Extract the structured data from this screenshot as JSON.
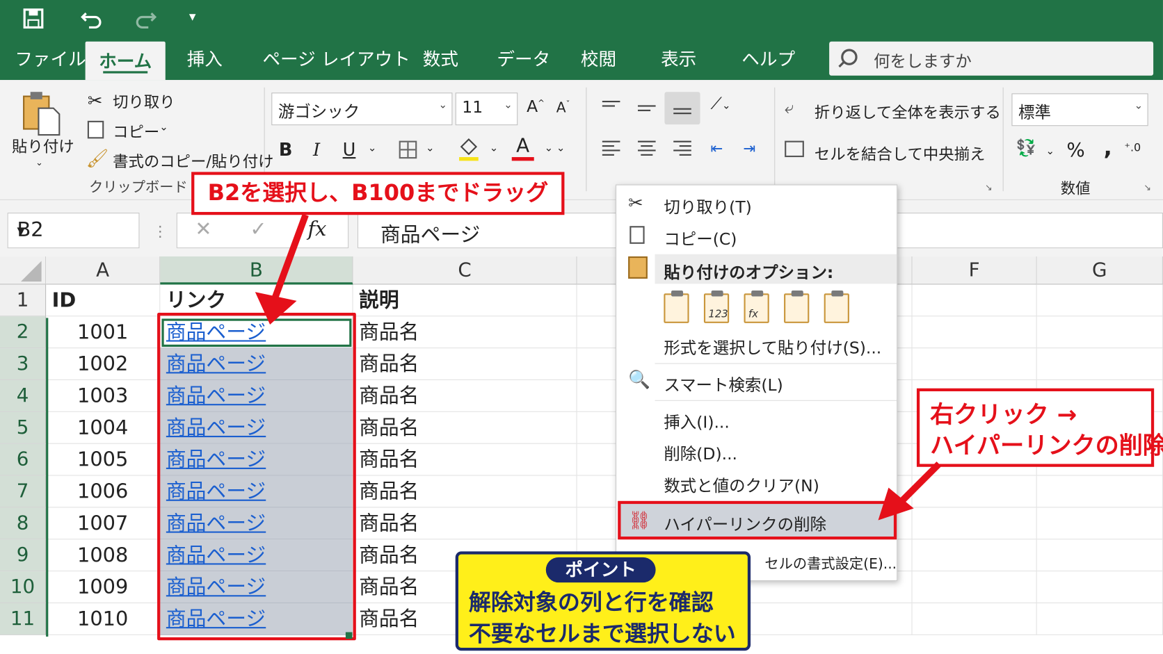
{
  "quick_access": {
    "save_icon": "save-icon",
    "undo_icon": "undo-icon",
    "redo_icon": "redo-icon",
    "customize": "▾"
  },
  "tabs": [
    {
      "label": "ファイル"
    },
    {
      "label": "ホーム",
      "active": true
    },
    {
      "label": "挿入"
    },
    {
      "label": "ページ レイアウト"
    },
    {
      "label": "数式"
    },
    {
      "label": "データ"
    },
    {
      "label": "校閲"
    },
    {
      "label": "表示"
    },
    {
      "label": "ヘルプ"
    }
  ],
  "search": {
    "placeholder": "何をしますか"
  },
  "clipboard": {
    "paste_label": "貼り付け",
    "cut_label": "切り取り",
    "copy_label": "コピー",
    "format_painter_label": "書式のコピー/貼り付け",
    "group_label": "クリップボード"
  },
  "font": {
    "family": "游ゴシック",
    "size": "11",
    "bold": "B",
    "italic": "I",
    "underline": "U",
    "grow": "A",
    "shrink": "A",
    "font_color": "A"
  },
  "alignment": {
    "wrap_text_label": "折り返して全体を表示する",
    "merge_center_label": "セルを結合して中央揃え"
  },
  "number": {
    "format": "標準",
    "percent": "%",
    "comma": ",",
    "group_label": "数値"
  },
  "formula_bar": {
    "name_box": "B2",
    "cancel": "✕",
    "enter": "✓",
    "fx": "fx",
    "content": "商品ページ"
  },
  "columns": [
    "A",
    "B",
    "C",
    "F",
    "G"
  ],
  "headers": {
    "id": "ID",
    "link": "リンク",
    "desc": "説明"
  },
  "rows": [
    {
      "num": "1"
    },
    {
      "num": "2",
      "id": "1001",
      "link": "商品ページ",
      "desc": "商品名"
    },
    {
      "num": "3",
      "id": "1002",
      "link": "商品ページ",
      "desc": "商品名"
    },
    {
      "num": "4",
      "id": "1003",
      "link": "商品ページ",
      "desc": "商品名"
    },
    {
      "num": "5",
      "id": "1004",
      "link": "商品ページ",
      "desc": "商品名"
    },
    {
      "num": "6",
      "id": "1005",
      "link": "商品ページ",
      "desc": "商品名"
    },
    {
      "num": "7",
      "id": "1006",
      "link": "商品ページ",
      "desc": "商品名"
    },
    {
      "num": "8",
      "id": "1007",
      "link": "商品ページ",
      "desc": "商品名"
    },
    {
      "num": "9",
      "id": "1008",
      "link": "商品ページ",
      "desc": "商品名"
    },
    {
      "num": "10",
      "id": "1009",
      "link": "商品ページ",
      "desc": "商品名"
    },
    {
      "num": "11",
      "id": "1010",
      "link": "商品ページ",
      "desc": "商品名"
    }
  ],
  "context_menu": {
    "cut": "切り取り(T)",
    "copy": "コピー(C)",
    "paste_options": "貼り付けのオプション:",
    "paste_special": "形式を選択して貼り付け(S)...",
    "smart_lookup": "スマート検索(L)",
    "insert": "挿入(I)...",
    "delete": "削除(D)...",
    "clear": "数式と値のクリア(N)",
    "remove_hyperlink": "ハイパーリンクの削除",
    "format_cells": "セルの書式設定(E)..."
  },
  "annotations": {
    "drag_callout": "B2を選択し、B100までドラッグ",
    "right_click_line1": "右クリック →",
    "right_click_line2": "ハイパーリンクの削除",
    "point_title": "ポイント",
    "point_line1": "解除対象の列と行を確認",
    "point_line2": "不要なセルまで選択しない"
  },
  "colors": {
    "excel_green": "#217346",
    "callout_red": "#e5101a",
    "point_yellow": "#ffef1a",
    "point_navy": "#1b2a6b",
    "selection_gray": "#c9ced6"
  }
}
